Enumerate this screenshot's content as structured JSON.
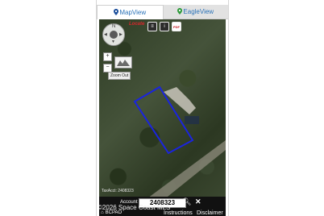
{
  "tabs": [
    {
      "label": "MapView",
      "active": true
    },
    {
      "label": "EagleView",
      "active": false
    }
  ],
  "map": {
    "logo_text": "Locate",
    "zoom_in": "+",
    "zoom_out": "−",
    "zoom_out_button_label": "Zoom Out",
    "tax_account_text": "TaxAcct: 2408323",
    "parcel_color": "#1a24e0"
  },
  "toolbar": {
    "layers_icon": "layers-icon",
    "info_icon": "info-icon",
    "pdf_label": "PDF"
  },
  "compass": {
    "north_label": "N"
  },
  "bottom": {
    "account_label": "Account",
    "account_value": "2408323",
    "copyright": "©2026 Space Coast MLS",
    "home_label": "BCPAO",
    "instructions": "Instructions",
    "disclaimer": "Disclaimer"
  },
  "colors": {
    "tab_text": "#2a72b8",
    "bottom_bar": "#111111",
    "parcel_outline": "#1a24e0"
  }
}
